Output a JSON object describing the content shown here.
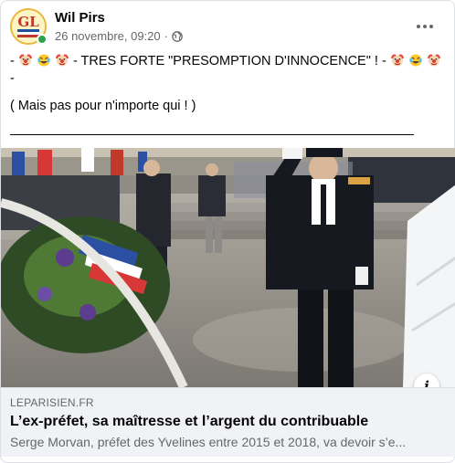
{
  "post": {
    "author": "Wil Pirs",
    "timestamp": "26 novembre, 09:20",
    "separator": "·",
    "audience_icon": "globe-icon",
    "more_icon": "more-options-icon",
    "text_line1_a": "- ",
    "text_line1_b": " - TRES FORTE \"PRESOMPTION D'INNOCENCE\" ! - ",
    "text_line2": "-",
    "text_line3": "( Mais pas pour n'importe qui ! )",
    "emojis": [
      "clown-face-icon",
      "rolling-laughing-icon",
      "clown-face-icon"
    ]
  },
  "avatar": {
    "label": "FRANÇAIS DE LA NATION",
    "icon": "avatar-logo-icon"
  },
  "link": {
    "domain": "LEPARISIEN.FR",
    "title": "L’ex-préfet, sa maîtresse et l’argent du contribuable",
    "description": "Serge Morvan, préfet des Yvelines entre 2015 et 2018, va devoir s’e...",
    "info_icon": "info-icon"
  },
  "colors": {
    "online": "#31a24c",
    "muted_text": "#65676b",
    "preview_bg": "#f0f2f5"
  }
}
